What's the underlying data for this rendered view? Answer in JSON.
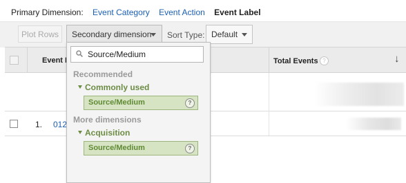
{
  "primary": {
    "label": "Primary Dimension:",
    "options": [
      "Event Category",
      "Event Action"
    ],
    "active": "Event Label"
  },
  "toolbar": {
    "plot_rows": "Plot Rows",
    "secondary_dimension": "Secondary dimension",
    "sort_type_label": "Sort Type:",
    "sort_type_value": "Default"
  },
  "table": {
    "header": {
      "event_label": "Event L",
      "total_events": "Total Events",
      "help": "?",
      "sort_arrow": "↓"
    },
    "rows": [
      {
        "num": "1.",
        "label": "012"
      }
    ]
  },
  "dropdown": {
    "search_value": "Source/Medium",
    "recommended": "Recommended",
    "commonly_used": "Commonly used",
    "item1": "Source/Medium",
    "more_dimensions": "More dimensions",
    "acquisition": "Acquisition",
    "item2": "Source/Medium",
    "help": "?"
  },
  "colors": {
    "link": "#1a5fb4",
    "group_green": "#6c8c44",
    "item_bg": "#d7e4c4"
  }
}
